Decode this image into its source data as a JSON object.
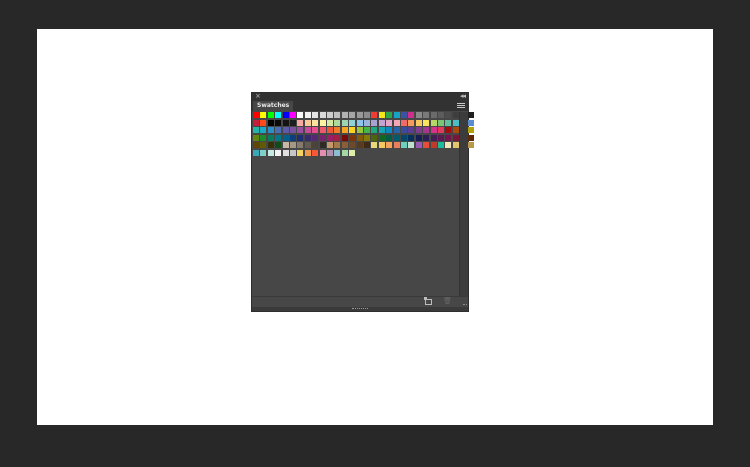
{
  "panel": {
    "tab_label": "Swatches",
    "close_glyph": "×",
    "collapse_glyph": "◂◂"
  },
  "icons": {
    "close": "close-icon",
    "collapse": "collapse-icon",
    "menu": "panel-menu-icon",
    "new_swatch": "new-swatch-icon",
    "delete": "trash-icon"
  },
  "colors": {
    "app_bg": "#282828",
    "canvas": "#ffffff",
    "panel_bg": "#474747",
    "panel_header": "#323232"
  },
  "swatches": [
    [
      "#ff0000",
      "#ffff00",
      "#00ff00",
      "#00ffff",
      "#0000ff",
      "#ff00ff",
      "#ffffff",
      "#f2f2f2",
      "#e6e6e6",
      "#d9d9d9",
      "#cccccc",
      "#bfbfbf",
      "#b3b3b3",
      "#a6a6a6",
      "#999999",
      "#8c8c8c",
      "#f03c32",
      "#f4e61a",
      "#2ca84a",
      "#16a3c8",
      "#3a53a4",
      "#cf2f8b",
      "#8a8a8a",
      "#7a7a7a",
      "#6b6b6b",
      "#5c5c5c",
      "#4d4d4d",
      "#3e3e3e",
      "#2f2f2f",
      "#202020"
    ],
    [
      "#c41e3a",
      "#ff4a1a",
      "#000000",
      "#0a0a0a",
      "#141414",
      "#1e1e1e",
      "#f7a8a0",
      "#f9c89b",
      "#fbe29e",
      "#fff5a0",
      "#d6e9a1",
      "#b1d99b",
      "#9fd4b3",
      "#8fd3d6",
      "#8cc4ea",
      "#9ab4dc",
      "#a8a3d3",
      "#c3a3d1",
      "#e3a6c8",
      "#f3a6b4",
      "#ef6a6a",
      "#f49a5a",
      "#f8c95e",
      "#fbe35b",
      "#b9d768",
      "#7cc576",
      "#5fc1a0",
      "#4bbfc5",
      "#43a9de",
      "#5a8bcd"
    ],
    [
      "#23b5a7",
      "#1fa9c4",
      "#2a8ec9",
      "#4a6db6",
      "#5e5aa8",
      "#7a52a3",
      "#9a4e9f",
      "#c44d9a",
      "#e74e8e",
      "#ee5a6b",
      "#e85a3a",
      "#f07c2a",
      "#f5a623",
      "#f9d423",
      "#9ac53c",
      "#45b548",
      "#1ea780",
      "#16a4b5",
      "#0f87c0",
      "#2964ab",
      "#3c4c9c",
      "#5a3e94",
      "#7e3c93",
      "#a83592",
      "#d6338a",
      "#e23a5f",
      "#a30d0d",
      "#aa4a0c",
      "#b07c0a",
      "#b0a20a"
    ],
    [
      "#63860f",
      "#1e8a2e",
      "#087c5c",
      "#06778a",
      "#045f8e",
      "#0c3f7e",
      "#1f2d72",
      "#3a2a70",
      "#56286f",
      "#78246c",
      "#9a1f67",
      "#a41f48",
      "#7a0909",
      "#7e3609",
      "#845c08",
      "#837a07",
      "#4a650b",
      "#146720",
      "#055c44",
      "#045a68",
      "#03476a",
      "#082e5e",
      "#161f55",
      "#2b1f54",
      "#411d53",
      "#5b1a51",
      "#74164d",
      "#7c1636",
      "#5a0505",
      "#5e2806"
    ],
    [
      "#5f4606",
      "#5e5a05",
      "#372f08",
      "#0f4d18",
      "#c8b8a6",
      "#a69887",
      "#857a6c",
      "#655c51",
      "#4a433a",
      "#302b25",
      "#c49a6c",
      "#a6794b",
      "#8a5f36",
      "#6e4a28",
      "#573a1f",
      "#3f2a16",
      "#e8d87a",
      "#f6c85f",
      "#f7a35c",
      "#e87e5a",
      "#6fcfbf",
      "#bde0d0",
      "#9b59b6",
      "#e74c3c",
      "#c0392b",
      "#1abc9c",
      "#f1e6b8",
      "#e5c36b",
      "#d4b15a",
      "#b8984a"
    ],
    [
      "#3aa6b9",
      "#7fd1c7",
      "#c7e9e4",
      "#f2f2f2",
      "#e0e0e0",
      "#c6c6c6",
      "#f4d35e",
      "#ee964b",
      "#f95738",
      "#e58fb0",
      "#b48ead",
      "#88c0d0",
      "#a3d9a5",
      "#ddeeaa"
    ]
  ]
}
